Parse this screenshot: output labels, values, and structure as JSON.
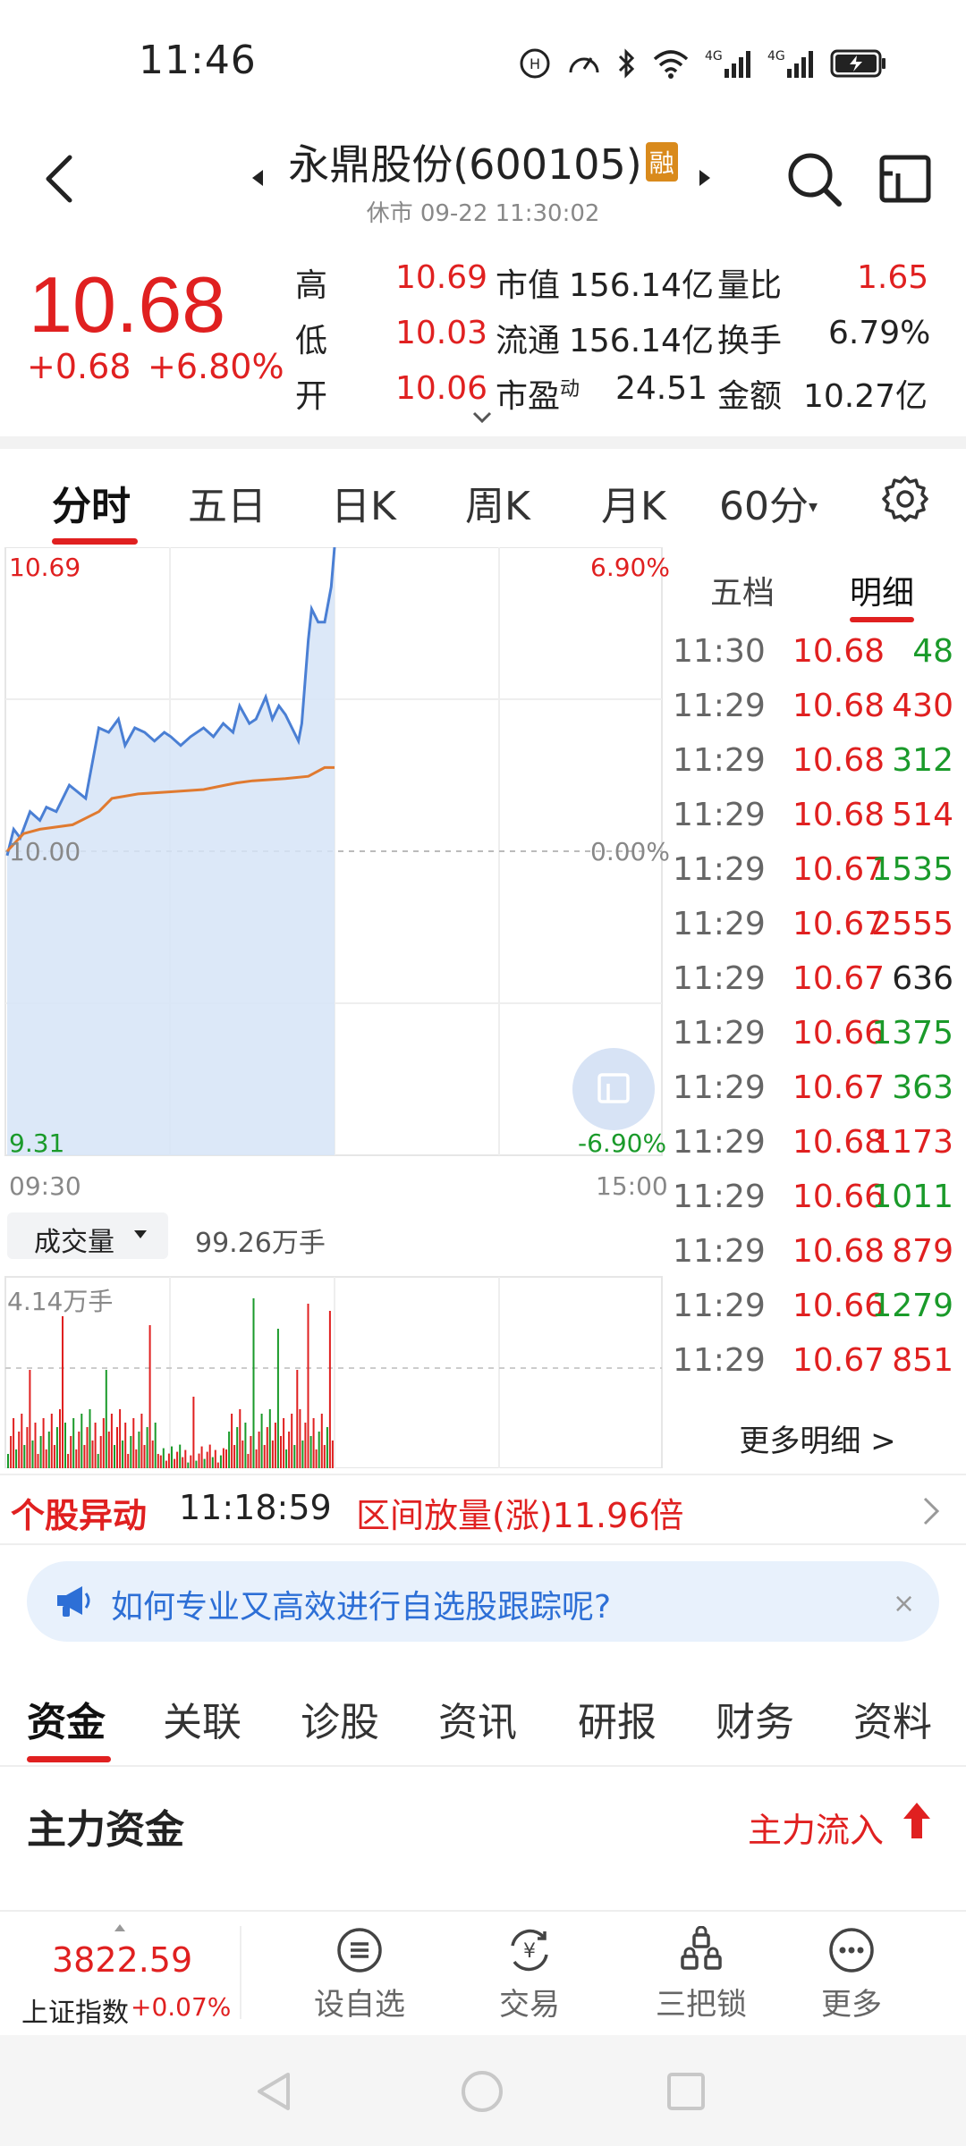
{
  "status_bar": {
    "time": "11:46"
  },
  "header": {
    "title": "永鼎股份(600105)",
    "badge": "融",
    "market_status": "休市 09-22 11:30:02"
  },
  "quote": {
    "price": "10.68",
    "change": "+0.68",
    "change_pct": "+6.80%",
    "fields": [
      {
        "label": "高",
        "value": "10.69",
        "value_color": "red"
      },
      {
        "label": "低",
        "value": "10.03",
        "value_color": "red"
      },
      {
        "label": "开",
        "value": "10.06",
        "value_color": "red"
      },
      {
        "label": "市值",
        "value": "156.14亿"
      },
      {
        "label": "流通",
        "value": "156.14亿"
      },
      {
        "label": "市盈",
        "sup": "动",
        "value": "24.51"
      },
      {
        "label": "量比",
        "value": "1.65",
        "value_color": "red"
      },
      {
        "label": "换手",
        "value": "6.79%"
      },
      {
        "label": "金额",
        "value": "10.27亿"
      }
    ]
  },
  "period_tabs": [
    "分时",
    "五日",
    "日K",
    "周K",
    "月K",
    "60分"
  ],
  "chart": {
    "price_high": "10.69",
    "pct_high": "6.90%",
    "price_base": "10.00",
    "pct_base": "0.00%",
    "price_low": "9.31",
    "pct_low": "-6.90%",
    "time_start": "09:30",
    "time_end": "15:00",
    "volume_selector": "成交量",
    "volume_total": "99.26万手",
    "volume_max": "4.14万手"
  },
  "chart_data": {
    "type": "line",
    "x_range": [
      "09:30",
      "15:00"
    ],
    "ylim": [
      9.31,
      10.69
    ],
    "reference_price": 10.0,
    "series": [
      {
        "name": "",
        "color": "#4a7fd4",
        "x_frac": [
          0.0,
          0.02,
          0.04,
          0.07,
          0.1,
          0.12,
          0.15,
          0.19,
          0.24,
          0.28,
          0.31,
          0.34,
          0.36,
          0.39,
          0.42,
          0.45,
          0.48,
          0.5,
          0.53,
          0.56,
          0.6,
          0.63,
          0.66,
          0.69,
          0.71,
          0.74,
          0.76,
          0.79,
          0.81,
          0.83,
          0.85,
          0.87,
          0.89,
          0.9,
          0.92,
          0.93,
          0.95,
          0.97,
          0.99,
          1.0
        ],
        "values": [
          9.99,
          10.05,
          10.03,
          10.09,
          10.07,
          10.1,
          10.09,
          10.15,
          10.12,
          10.28,
          10.27,
          10.3,
          10.24,
          10.28,
          10.27,
          10.25,
          10.27,
          10.26,
          10.24,
          10.26,
          10.28,
          10.26,
          10.29,
          10.27,
          10.33,
          10.29,
          10.3,
          10.35,
          10.3,
          10.33,
          10.31,
          10.28,
          10.25,
          10.29,
          10.48,
          10.55,
          10.52,
          10.52,
          10.6,
          10.69
        ]
      },
      {
        "name": "",
        "color": "#e07a30",
        "x_frac": [
          0.0,
          0.05,
          0.1,
          0.2,
          0.28,
          0.32,
          0.4,
          0.5,
          0.6,
          0.7,
          0.75,
          0.85,
          0.92,
          0.97,
          1.0
        ],
        "values": [
          10.0,
          10.04,
          10.05,
          10.06,
          10.09,
          10.12,
          10.13,
          10.135,
          10.14,
          10.155,
          10.16,
          10.165,
          10.17,
          10.19,
          10.19
        ]
      }
    ]
  },
  "trade_tabs": [
    "五档",
    "明细"
  ],
  "trades": [
    {
      "time": "11:30",
      "price": "10.68",
      "vol": "48",
      "pc": "red",
      "vc": "green"
    },
    {
      "time": "11:29",
      "price": "10.68",
      "vol": "430",
      "pc": "red",
      "vc": "red"
    },
    {
      "time": "11:29",
      "price": "10.68",
      "vol": "312",
      "pc": "red",
      "vc": "green"
    },
    {
      "time": "11:29",
      "price": "10.68",
      "vol": "514",
      "pc": "red",
      "vc": "red"
    },
    {
      "time": "11:29",
      "price": "10.67",
      "vol": "1535",
      "pc": "red",
      "vc": "green"
    },
    {
      "time": "11:29",
      "price": "10.67",
      "vol": "2555",
      "pc": "red",
      "vc": "red"
    },
    {
      "time": "11:29",
      "price": "10.67",
      "vol": "636",
      "pc": "red",
      "vc": "dark"
    },
    {
      "time": "11:29",
      "price": "10.66",
      "vol": "1375",
      "pc": "red",
      "vc": "green"
    },
    {
      "time": "11:29",
      "price": "10.67",
      "vol": "363",
      "pc": "red",
      "vc": "green"
    },
    {
      "time": "11:29",
      "price": "10.68",
      "vol": "1173",
      "pc": "red",
      "vc": "red"
    },
    {
      "time": "11:29",
      "price": "10.66",
      "vol": "1011",
      "pc": "red",
      "vc": "green"
    },
    {
      "time": "11:29",
      "price": "10.68",
      "vol": "879",
      "pc": "red",
      "vc": "red"
    },
    {
      "time": "11:29",
      "price": "10.66",
      "vol": "1279",
      "pc": "red",
      "vc": "green"
    },
    {
      "time": "11:29",
      "price": "10.67",
      "vol": "851",
      "pc": "red",
      "vc": "red"
    }
  ],
  "more_detail": "更多明细 >",
  "alert": {
    "tag": "个股异动",
    "time": "11:18:59",
    "text": "区间放量(涨)11.96倍"
  },
  "tip_banner": {
    "text": "如何专业又高效进行自选股跟踪呢?",
    "close": "×"
  },
  "section_tabs": [
    "资金",
    "关联",
    "诊股",
    "资讯",
    "研报",
    "财务",
    "资料"
  ],
  "main_fund": {
    "title": "主力资金",
    "inflow": "主力流入"
  },
  "bottom_nav": {
    "index_value": "3822.59",
    "index_name": "上证指数",
    "index_pct": "+0.07%",
    "items": [
      "设自选",
      "交易",
      "三把锁",
      "更多"
    ]
  },
  "colors": {
    "up": "#e02020",
    "down": "#1a9a2a",
    "price_line": "#4a7fd4",
    "avg_line": "#e07a30",
    "accent_blue": "#2d6fd6"
  }
}
